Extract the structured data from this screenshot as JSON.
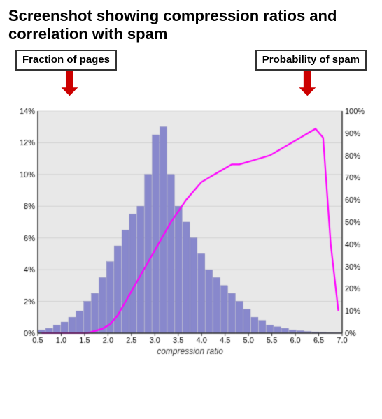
{
  "title": "Screenshot showing compression ratios and correlation with spam",
  "label_left": "Fraction of pages",
  "label_right": "Probability of spam",
  "chart": {
    "x_axis_label": "compression ratio",
    "x_ticks": [
      "0.5",
      "1.0",
      "1.5",
      "2.0",
      "2.5",
      "3.0",
      "3.5",
      "4.0",
      "4.5",
      "5.0",
      "5.5",
      "6.0",
      "6.5",
      "7.0"
    ],
    "y_left_ticks": [
      "0%",
      "2%",
      "4%",
      "6%",
      "8%",
      "10%",
      "12%",
      "14%"
    ],
    "y_right_ticks": [
      "0%",
      "10%",
      "20%",
      "30%",
      "40%",
      "50%",
      "60%",
      "70%",
      "80%",
      "90%",
      "100%"
    ],
    "histogram_color": "#8888cc",
    "spam_line_color": "#ff00ff",
    "histogram_data": [
      0.2,
      0.3,
      0.5,
      0.7,
      1.0,
      1.4,
      2.0,
      2.5,
      3.5,
      4.5,
      5.5,
      6.5,
      7.5,
      8.0,
      10.0,
      12.5,
      13.0,
      10.0,
      8.0,
      7.0,
      6.0,
      5.0,
      4.0,
      3.5,
      3.0,
      2.5,
      2.0,
      1.5,
      1.0,
      0.8,
      0.5,
      0.4,
      0.3,
      0.2,
      0.15,
      0.1,
      0.08,
      0.05,
      0.03,
      0.02
    ],
    "spam_data": [
      0,
      0,
      0,
      0,
      0,
      0,
      0,
      1,
      2,
      4,
      8,
      14,
      20,
      26,
      32,
      38,
      44,
      50,
      55,
      60,
      64,
      68,
      70,
      72,
      74,
      76,
      76,
      77,
      78,
      79,
      80,
      82,
      84,
      86,
      88,
      90,
      92,
      88,
      40,
      10
    ]
  }
}
